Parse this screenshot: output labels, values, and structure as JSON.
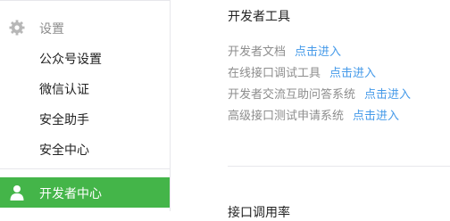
{
  "sidebar": {
    "section_label": "设置",
    "items": [
      {
        "label": "公众号设置"
      },
      {
        "label": "微信认证"
      },
      {
        "label": "安全助手"
      },
      {
        "label": "安全中心"
      }
    ],
    "active_item": {
      "label": "开发者中心"
    },
    "icons": {
      "section": "gear-icon",
      "active": "user-icon"
    },
    "colors": {
      "active_bg": "#44b549",
      "section_text": "#8d8d8d"
    }
  },
  "main": {
    "title": "开发者工具",
    "tools": [
      {
        "name": "开发者文档",
        "link": "点击进入"
      },
      {
        "name": "在线接口调试工具",
        "link": "点击进入"
      },
      {
        "name": "开发者交流互助问答系统",
        "link": "点击进入"
      },
      {
        "name": "高级接口测试申请系统",
        "link": "点击进入"
      }
    ],
    "cut_title": "接口调用率",
    "colors": {
      "link": "#459ae9",
      "muted": "#8d8d8d"
    }
  }
}
